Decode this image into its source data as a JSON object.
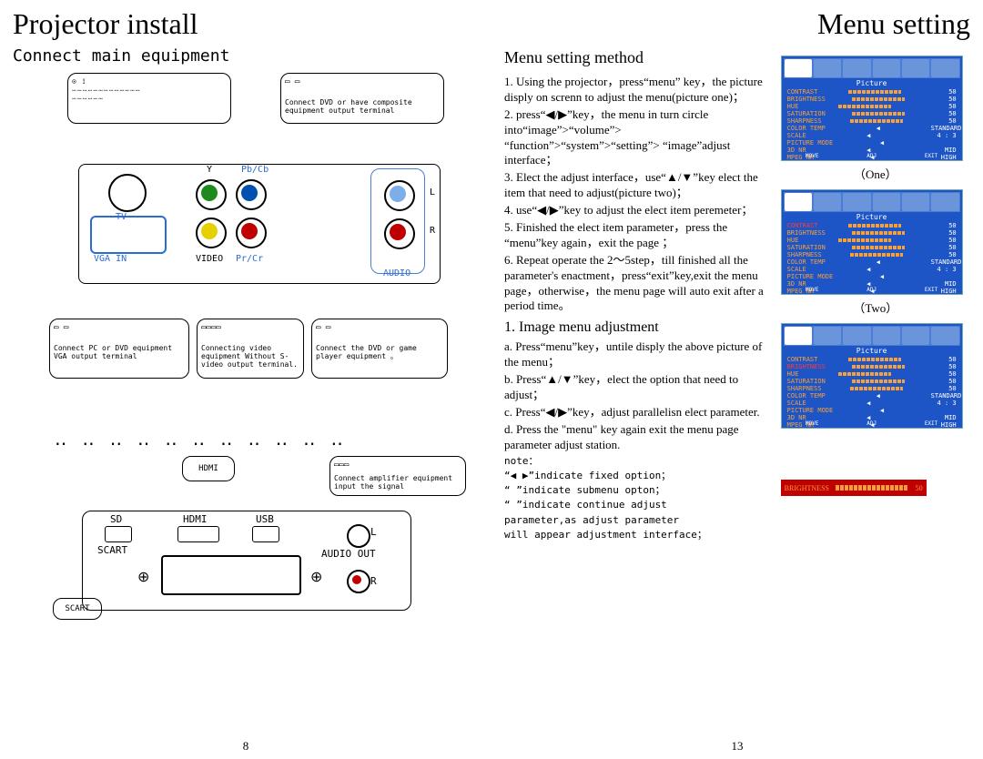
{
  "left": {
    "title": "Projector install",
    "subtitle": "Connect main equipment",
    "page_num": "8",
    "box_d2": "Connect DVD or have composite equipment output terminal",
    "box_d3": "Connect PC or DVD equipment VGA output terminal",
    "box_d4": "Connecting video equipment Without S-video output terminal.",
    "box_d5": "Connect the DVD or game player equipment 。",
    "hdmi_label": "HDMI",
    "hdmi_desc": "Connect amplifier equipment input the signal",
    "scart_label": "SCART",
    "panel_labels": {
      "tv": "TV",
      "y": "Y",
      "pbcb": "Pb/Cb",
      "vgain": "VGA IN",
      "video": "VIDEO",
      "prcr": "Pr/Cr",
      "audio": "AUDIO",
      "l": "L",
      "r": "R"
    },
    "io_labels": {
      "sd": "SD",
      "hdmi": "HDMI",
      "usb": "USB",
      "scart": "SCART",
      "audioout": "AUDIO OUT",
      "l": "L",
      "r": "R"
    },
    "dots": "‥ ‥ ‥ ‥ ‥ ‥ ‥ ‥ ‥ ‥ ‥"
  },
  "right": {
    "title": "Menu setting",
    "subtitle": "Menu setting method",
    "page_num": "13",
    "steps": [
      "1. Using the projector，press“menu” key，the picture disply on screnn to adjust the menu(picture one)；",
      "2. press“◀/▶”key，the menu in turn circle into“image”>“volume”> “function”>“system”>“setting”> “image”adjust interface；",
      "3. Elect the adjust interface，use“▲/▼”key elect the item that need to adjust(picture two)；",
      "4. use“◀/▶”key to adjust the elect item peremeter；",
      "5. Finished the elect item parameter，press the “menu”key again，exit the page ；",
      "6. Repeat operate the 2～5step，till finished all the parameter's enactment，press“exit”key,exit the menu page，otherwise，the menu page will auto exit after a period time。"
    ],
    "image_adj_title": "1. Image menu adjustment",
    "image_adj": [
      "a. Press“menu”key，untile disply the above picture of the menu；",
      "b. Press“▲/▼”key，elect the option that need to adjust；",
      "c. Press“◀/▶”key，adjust parallelisn elect parameter.",
      "d. Press the \"menu\" key again exit the menu page parameter adjust station."
    ],
    "note_title": "note：",
    "note_lines": [
      "“◀ ▶”indicate fixed option；",
      "“    ”indicate submenu opton；",
      "“    ”indicate continue adjust",
      "parameter,as adjust parameter",
      "will appear adjustment interface；"
    ],
    "caption_one": "（One）",
    "caption_two": "（Two）",
    "osd": {
      "title": "Picture",
      "items": [
        {
          "name": "CONTRAST",
          "val": "50",
          "type": "bar"
        },
        {
          "name": "BRIGHTNESS",
          "val": "50",
          "type": "bar"
        },
        {
          "name": "HUE",
          "val": "50",
          "type": "bar"
        },
        {
          "name": "SATURATION",
          "val": "50",
          "type": "bar"
        },
        {
          "name": "SHARPNESS",
          "val": "50",
          "type": "bar"
        },
        {
          "name": "COLOR TEMP",
          "val": "STANDARD",
          "type": "txt"
        },
        {
          "name": "SCALE",
          "val": "4 : 3",
          "type": "txt"
        },
        {
          "name": "PICTURE MODE",
          "val": "",
          "type": "txt"
        },
        {
          "name": "3D NR",
          "val": "MID",
          "type": "txt"
        },
        {
          "name": "MPEG NR",
          "val": "HIGH",
          "type": "txt"
        }
      ],
      "foot": [
        "MOVE",
        "ADJ",
        "EXIT"
      ],
      "slider_label": "BRIGHTNESS",
      "slider_val": "50"
    }
  }
}
